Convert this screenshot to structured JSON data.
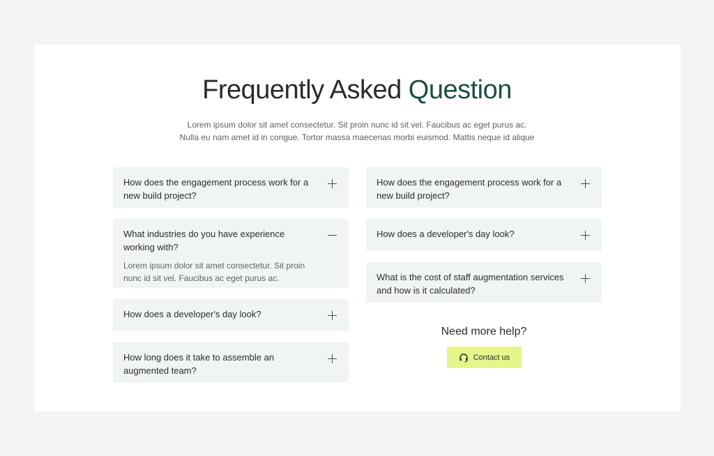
{
  "header": {
    "title_main": "Frequently Asked",
    "title_accent": "Question",
    "subtitle_line1": "Lorem ipsum dolor sit amet consectetur. Sit proin nunc id sit vel. Faucibus ac eget purus ac.",
    "subtitle_line2": "Nulla eu nam amet id in congue. Tortor massa maecenas morbi euismod. Mattis neque id alique"
  },
  "left_faqs": [
    {
      "question": "How does the engagement process work for a new build project?",
      "state": "collapsed"
    },
    {
      "question": "What industries do you have experience working with?",
      "state": "expanded",
      "answer": "Lorem ipsum dolor sit amet consectetur. Sit proin nunc id sit vel. Faucibus ac eget purus ac."
    },
    {
      "question": "How does a developer's day look?",
      "state": "collapsed"
    },
    {
      "question": "How long does it take to assemble an augmented team?",
      "state": "collapsed"
    }
  ],
  "right_faqs": [
    {
      "question": "How does the engagement process work for a new build project?",
      "state": "collapsed"
    },
    {
      "question": "How does a developer's day look?",
      "state": "collapsed"
    },
    {
      "question": "What is the cost of staff augmentation services and how is it calculated?",
      "state": "collapsed"
    }
  ],
  "help": {
    "title": "Need more help?",
    "button_label": "Contact us",
    "button_icon": "headset-icon"
  },
  "colors": {
    "accent": "#1e4d45",
    "faq_bg": "#f1f5f2",
    "button_bg": "#e6f58a",
    "page_bg": "#f4f4f4"
  }
}
